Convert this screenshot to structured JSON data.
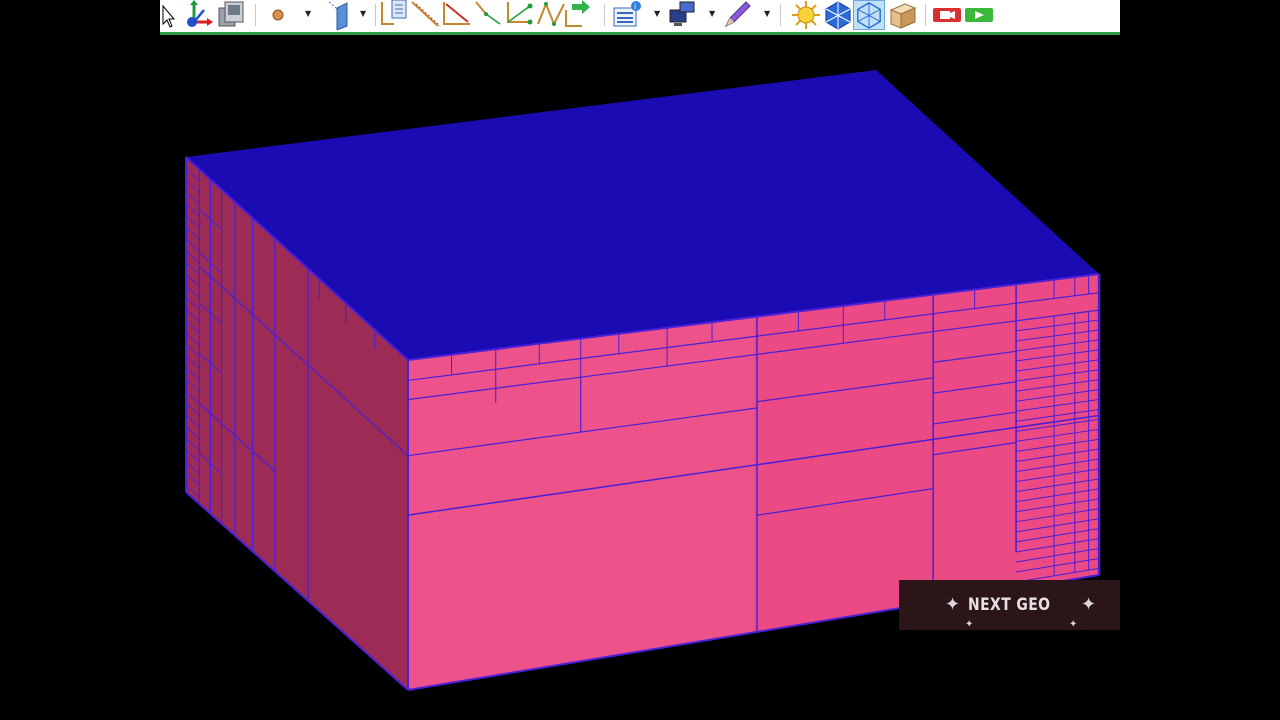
{
  "toolbar": {
    "accent_color": "#2ea043",
    "tools": [
      {
        "name": "select-arrow-icon"
      },
      {
        "name": "axes-transform-icon"
      },
      {
        "name": "view-stack-icon"
      },
      {
        "name": "point-sphere-icon"
      },
      {
        "name": "plane-icon"
      },
      {
        "name": "document-icon"
      },
      {
        "name": "line-icon"
      },
      {
        "name": "angle-line-icon"
      },
      {
        "name": "polyline-icon"
      },
      {
        "name": "curve-node-icon"
      },
      {
        "name": "zigzag-icon"
      },
      {
        "name": "connect-arrow-icon"
      },
      {
        "name": "list-info-icon"
      },
      {
        "name": "network-computer-icon"
      },
      {
        "name": "pencil-icon"
      },
      {
        "name": "sun-light-icon"
      },
      {
        "name": "hexagon-mesh-icon"
      },
      {
        "name": "hexagon-wireframe-icon"
      },
      {
        "name": "box-solid-icon"
      },
      {
        "name": "record-icon"
      },
      {
        "name": "play-icon"
      }
    ]
  },
  "model": {
    "top_color": "#1a0bb3",
    "front_color": "#ec4a84",
    "left_color": "#9c2b55",
    "edge_color": "#4a1fd8"
  },
  "overlay": {
    "label": "NEXT GEO"
  }
}
